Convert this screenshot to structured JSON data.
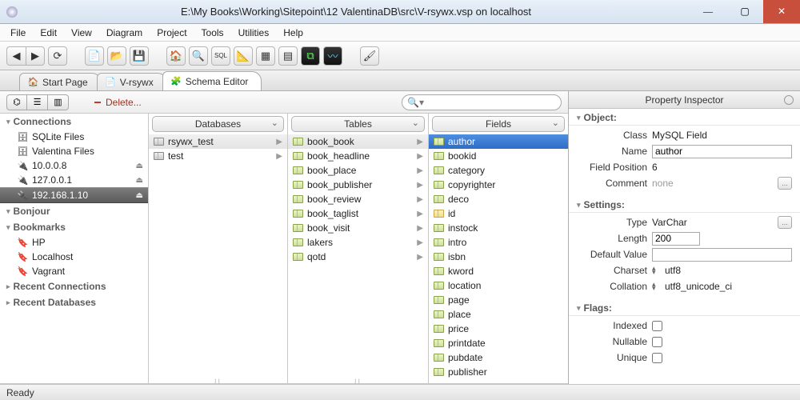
{
  "title": "E:\\My Books\\Working\\Sitepoint\\12 ValentinaDB\\src\\V-rsywx.vsp on localhost",
  "menubar": [
    "File",
    "Edit",
    "View",
    "Diagram",
    "Project",
    "Tools",
    "Utilities",
    "Help"
  ],
  "tabs": [
    {
      "label": "Start Page",
      "icon": "🏠"
    },
    {
      "label": "V-rsywx",
      "icon": "📄"
    },
    {
      "label": "Schema Editor",
      "icon": "🧩",
      "active": true
    }
  ],
  "cmd": {
    "delete": "Delete...",
    "search_placeholder": ""
  },
  "sidebar": {
    "sections": [
      {
        "title": "Connections",
        "items": [
          {
            "label": "SQLite Files",
            "icon": "🗄"
          },
          {
            "label": "Valentina Files",
            "icon": "🗄"
          },
          {
            "label": "10.0.0.8",
            "icon": "🔌",
            "eject": true
          },
          {
            "label": "127.0.0.1",
            "icon": "🔌",
            "eject": true
          },
          {
            "label": "192.168.1.10",
            "icon": "🔌",
            "eject": true,
            "selected": true
          }
        ]
      },
      {
        "title": "Bonjour",
        "items": []
      },
      {
        "title": "Bookmarks",
        "items": [
          {
            "label": "HP",
            "icon": "🔖"
          },
          {
            "label": "Localhost",
            "icon": "🔖"
          },
          {
            "label": "Vagrant",
            "icon": "🔖"
          }
        ]
      },
      {
        "title": "Recent Connections",
        "collapsed": true,
        "items": []
      },
      {
        "title": "Recent Databases",
        "collapsed": true,
        "items": []
      }
    ]
  },
  "columns": {
    "databases": {
      "title": "Databases",
      "items": [
        {
          "label": "rsywx_test",
          "selected": true
        },
        {
          "label": "test"
        }
      ]
    },
    "tables": {
      "title": "Tables",
      "items": [
        {
          "label": "book_book",
          "selected": true
        },
        {
          "label": "book_headline"
        },
        {
          "label": "book_place"
        },
        {
          "label": "book_publisher"
        },
        {
          "label": "book_review"
        },
        {
          "label": "book_taglist"
        },
        {
          "label": "book_visit"
        },
        {
          "label": "lakers"
        },
        {
          "label": "qotd"
        }
      ]
    },
    "fields": {
      "title": "Fields",
      "items": [
        {
          "label": "author",
          "selected": true
        },
        {
          "label": "bookid"
        },
        {
          "label": "category"
        },
        {
          "label": "copyrighter"
        },
        {
          "label": "deco"
        },
        {
          "label": "id",
          "pk": true
        },
        {
          "label": "instock"
        },
        {
          "label": "intro"
        },
        {
          "label": "isbn"
        },
        {
          "label": "kword"
        },
        {
          "label": "location"
        },
        {
          "label": "page"
        },
        {
          "label": "place"
        },
        {
          "label": "price"
        },
        {
          "label": "printdate"
        },
        {
          "label": "pubdate"
        },
        {
          "label": "publisher"
        }
      ]
    }
  },
  "inspector": {
    "title": "Property Inspector",
    "object": {
      "class": "MySQL Field",
      "name": "author",
      "field_position": "6",
      "comment": "none"
    },
    "object_labels": {
      "class": "Class",
      "name": "Name",
      "field_position": "Field Position",
      "comment": "Comment"
    },
    "settings": {
      "type": "VarChar",
      "length": "200",
      "default_value": "",
      "charset": "utf8",
      "collation": "utf8_unicode_ci"
    },
    "settings_labels": {
      "type": "Type",
      "length": "Length",
      "default_value": "Default Value",
      "charset": "Charset",
      "collation": "Collation"
    },
    "flags_labels": {
      "indexed": "Indexed",
      "nullable": "Nullable",
      "unique": "Unique"
    },
    "section_titles": {
      "object": "Object:",
      "settings": "Settings:",
      "flags": "Flags:"
    }
  },
  "status": "Ready"
}
